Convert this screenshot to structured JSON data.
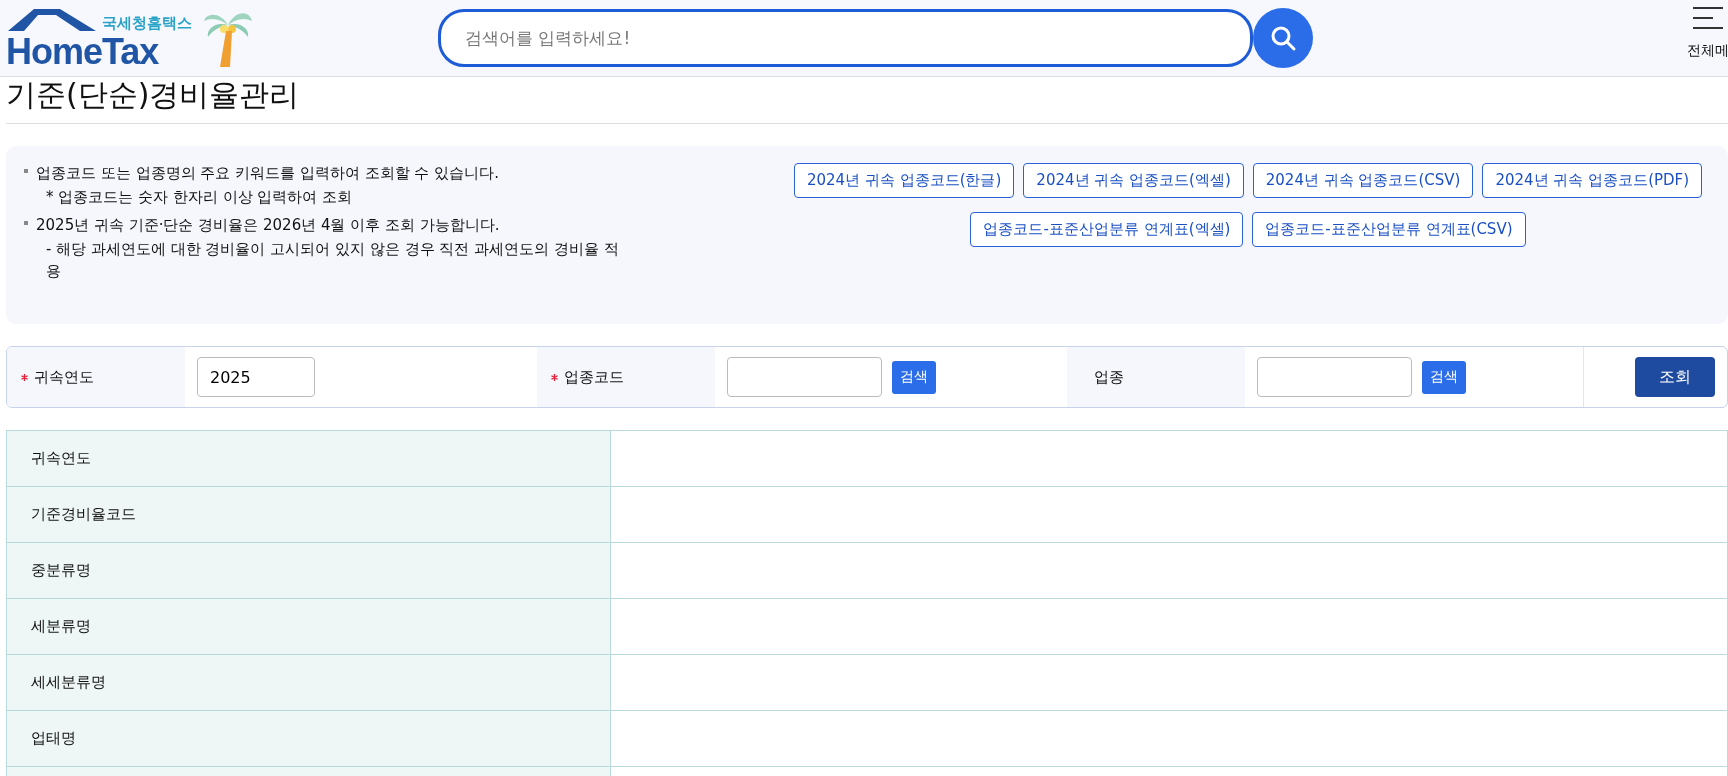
{
  "header": {
    "logo_subtitle": "국세청홈택스",
    "logo_title": "HomeTax",
    "search": {
      "placeholder": "검색어를 입력하세요!"
    },
    "menu_label": "전체메"
  },
  "page_title": "기준(단순)경비율관리",
  "notice": {
    "items": [
      {
        "text": "업종코드 또는 업종명의 주요 키워드를 입력하여 조회할 수 있습니다.",
        "notes": [
          "* 업종코드는 숫자 한자리 이상 입력하여 조회"
        ]
      },
      {
        "text": "2025년 귀속 기준·단순 경비율은 2026년 4월 이후 조회 가능합니다.",
        "notes": [
          "- 해당 과세연도에 대한 경비율이 고시되어 있지 않은 경우 직전 과세연도의 경비율 적용"
        ]
      }
    ],
    "download_rows": [
      [
        "2024년 귀속 업종코드(한글)",
        "2024년 귀속 업종코드(엑셀)",
        "2024년 귀속 업종코드(CSV)",
        "2024년 귀속 업종코드(PDF)"
      ],
      [
        "업종코드-표준산업분류 연계표(엑셀)",
        "업종코드-표준산업분류 연계표(CSV)"
      ]
    ]
  },
  "search_form": {
    "fields": [
      {
        "label": "귀속연도",
        "required": true,
        "value": "2025"
      },
      {
        "label": "업종코드",
        "required": true,
        "button": "검색"
      },
      {
        "label": "업종",
        "required": false,
        "button": "검색"
      }
    ],
    "submit": "조회"
  },
  "result_table": {
    "rows": [
      "귀속연도",
      "기준경비율코드",
      "중분류명",
      "세분류명",
      "세세분류명",
      "업태명"
    ]
  }
}
